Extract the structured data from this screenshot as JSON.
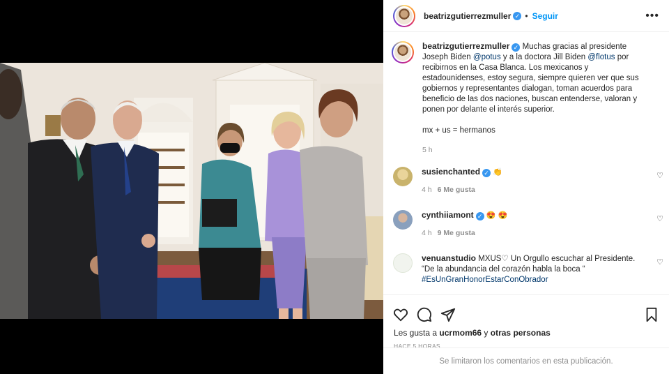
{
  "post": {
    "username": "beatrizgutierrezmuller",
    "follow_label": "Seguir",
    "more_label": "•••",
    "caption": {
      "pre1": "Muchas gracias al presidente Joseph Biden ",
      "mention1": "@potus",
      "pre2": " y a la doctora Jill Biden ",
      "mention2": "@flotus",
      "rest": " por recibirnos en la Casa Blanca. Los mexicanos y estadounidenses, estoy segura, siempre quieren ver que sus gobiernos y representantes dialogan, toman acuerdos para beneficio de las dos naciones, buscan entenderse, valoran y ponen por delante el interés superior.",
      "line2": "mx + us = hermanos",
      "time": "5 h"
    }
  },
  "comments": [
    {
      "user": "susienchanted",
      "text": "",
      "emoji": "👏",
      "time": "4 h",
      "likes": "6 Me gusta"
    },
    {
      "user": "cynthiiamont",
      "text": "",
      "emoji": "😍 😍",
      "time": "4 h",
      "likes": "9 Me gusta"
    },
    {
      "user": "venuanstudio",
      "text": " MXUS♡ Un Orgullo escuchar al Presidente. “De la abundancia del corazón habla la boca “ ",
      "hashtag": "#EsUnGranHonorEstarConObrador"
    }
  ],
  "footer": {
    "likes_prefix": "Les gusta a ",
    "likes_user": "ucrmom66",
    "likes_mid": " y ",
    "likes_others": "otras personas",
    "timestamp": "HACE 5 HORAS",
    "comments_closed": "Se limitaron los comentarios en esta publicación."
  },
  "colors": {
    "accent": "#0095f6",
    "verified": "#3897f0",
    "mention": "#00376b"
  }
}
